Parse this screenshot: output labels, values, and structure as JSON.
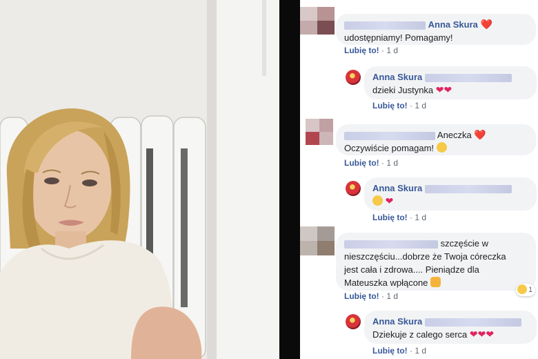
{
  "photo": {
    "icon": "portrait-photo"
  },
  "comments": [
    {
      "level": 0,
      "prefix_text": "",
      "name": "Anna Skura",
      "name_suffix": "❤️",
      "text": "udostępniamy! Pomagamy!",
      "like_label": "Lubię to!",
      "time": "1 d"
    },
    {
      "level": 1,
      "name": "Anna Skura",
      "text": "dzieki Justynka",
      "hearts": "❤❤",
      "like_label": "Lubię to!",
      "time": "1 d"
    },
    {
      "level": 0,
      "name": "Aneczka",
      "name_suffix": "❤️",
      "text": "Oczywiście pomagam!",
      "like_label": "Lubię to!",
      "time": "1 d"
    },
    {
      "level": 1,
      "name": "Anna Skura",
      "hearts": "❤",
      "like_label": "Lubię to!",
      "time": "1 d"
    },
    {
      "level": 0,
      "line1": "szczęście w",
      "line2": "nieszczęściu...dobrze że Twoja córeczka",
      "line3": "jest cała i zdrowa.... Pieniądze dla",
      "line4": "Mateuszka wpłącone",
      "reaction_count": "1",
      "like_label": "Lubię to!",
      "time": "1 d"
    },
    {
      "level": 1,
      "name": "Anna Skura",
      "text": "Dziekuje z calego serca",
      "hearts": "❤❤❤",
      "like_label": "Lubię to!",
      "time": "1 d"
    }
  ],
  "separator": "·",
  "colors": {
    "link": "#385898",
    "bubble": "#f2f3f5",
    "heart": "#e0245e",
    "meta": "#606770"
  }
}
